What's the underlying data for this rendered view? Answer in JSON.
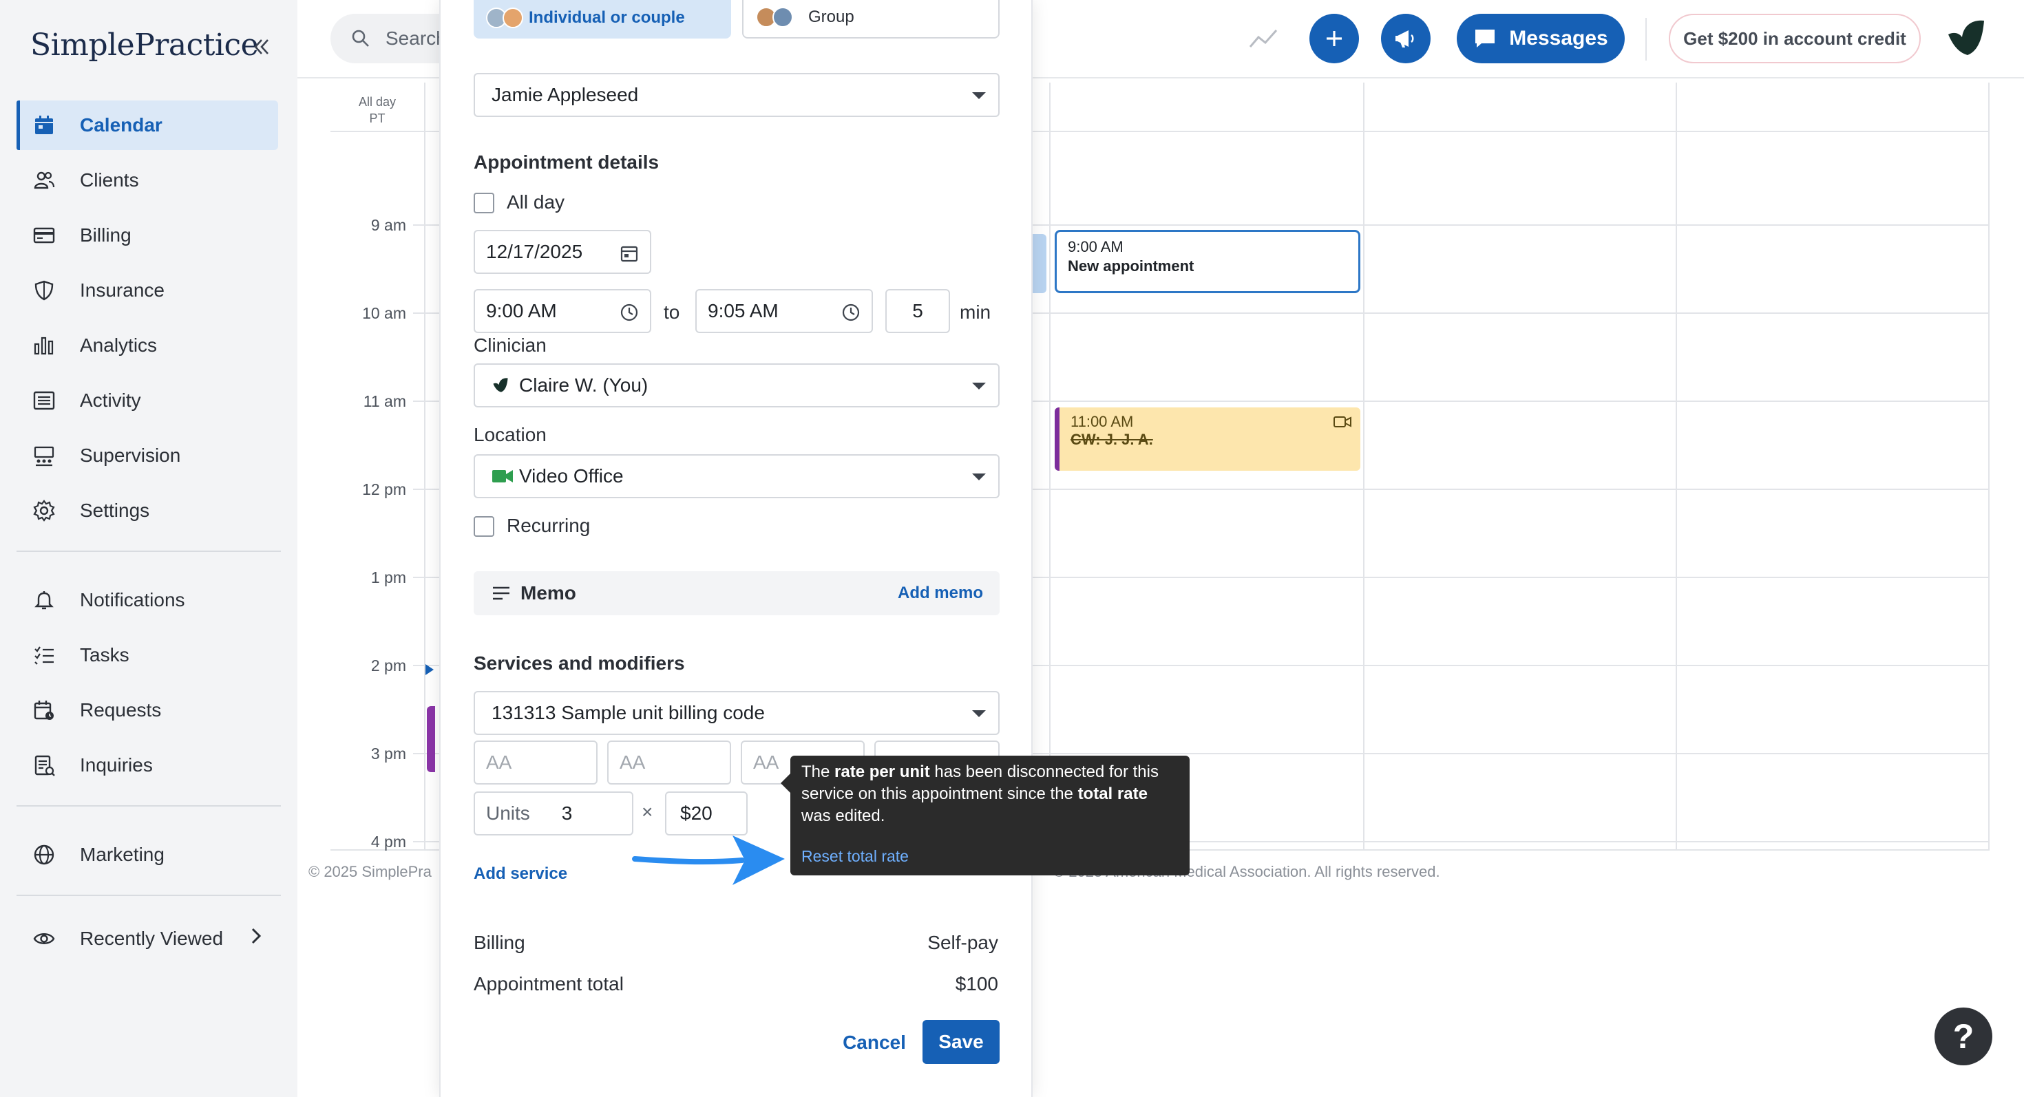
{
  "app": {
    "logo_text": "SimplePractice",
    "collapse_icon": "double-chevron-left-icon"
  },
  "sidebar": {
    "items": [
      {
        "label": "Calendar",
        "icon": "calendar-icon",
        "active": true
      },
      {
        "label": "Clients",
        "icon": "clients-icon"
      },
      {
        "label": "Billing",
        "icon": "billing-card-icon"
      },
      {
        "label": "Insurance",
        "icon": "shield-icon"
      },
      {
        "label": "Analytics",
        "icon": "bar-chart-icon"
      },
      {
        "label": "Activity",
        "icon": "activity-list-icon"
      },
      {
        "label": "Supervision",
        "icon": "supervision-icon"
      },
      {
        "label": "Settings",
        "icon": "gear-icon"
      }
    ],
    "secondary": [
      {
        "label": "Notifications",
        "icon": "bell-icon"
      },
      {
        "label": "Tasks",
        "icon": "tasks-checklist-icon"
      },
      {
        "label": "Requests",
        "icon": "requests-calendar-icon"
      },
      {
        "label": "Inquiries",
        "icon": "inquiries-icon"
      }
    ],
    "marketing": {
      "label": "Marketing",
      "icon": "globe-icon"
    },
    "recently_viewed": {
      "label": "Recently Viewed",
      "icon": "eye-icon"
    }
  },
  "topbar": {
    "search_placeholder": "Search",
    "messages_label": "Messages",
    "credit_label": "Get $200 in account credit",
    "accent_color": "#1660b5"
  },
  "calendar": {
    "allday_label": "All day",
    "timezone_label": "PT",
    "hours": [
      "9 am",
      "10 am",
      "11 am",
      "12 pm",
      "1 pm",
      "2 pm",
      "3 pm",
      "4 pm"
    ],
    "events": [
      {
        "time": "9:00 AM",
        "title": "New appointment"
      },
      {
        "time": "11:00 AM",
        "title": "CW: J. J. A.",
        "color": "#fde6ad"
      }
    ],
    "footer_left": "© 2025 SimplePra",
    "footer_right": "© 2025 American Medical Association. All rights reserved."
  },
  "appointment": {
    "type_tabs": [
      {
        "label": "Individual or couple",
        "selected": true
      },
      {
        "label": "Group",
        "selected": false
      }
    ],
    "client": "Jamie Appleseed",
    "details_title": "Appointment details",
    "all_day_label": "All day",
    "date": "12/17/2025",
    "start_time": "9:00 AM",
    "to_label": "to",
    "end_time": "9:05 AM",
    "duration": "5",
    "duration_unit": "min",
    "clinician_label": "Clinician",
    "clinician": "Claire W. (You)",
    "location_label": "Location",
    "location": "Video Office",
    "recurring_label": "Recurring",
    "memo_label": "Memo",
    "add_memo_label": "Add memo",
    "services_title": "Services and modifiers",
    "service": "131313 Sample unit billing code",
    "modifier_placeholder": "AA",
    "units_label": "Units",
    "units_value": "3",
    "times_symbol": "×",
    "rate": "$20",
    "add_service_label": "Add service",
    "billing_label": "Billing",
    "billing_value": "Self-pay",
    "total_label": "Appointment total",
    "total_value": "$100",
    "cancel_label": "Cancel",
    "save_label": "Save"
  },
  "tooltip": {
    "part1": "The ",
    "bold1": "rate per unit",
    "part2": " has been disconnected for this service on this appointment since the ",
    "bold2": "total rate",
    "part3": " was edited.",
    "reset_label": "Reset total rate"
  },
  "help": {
    "label": "?"
  }
}
